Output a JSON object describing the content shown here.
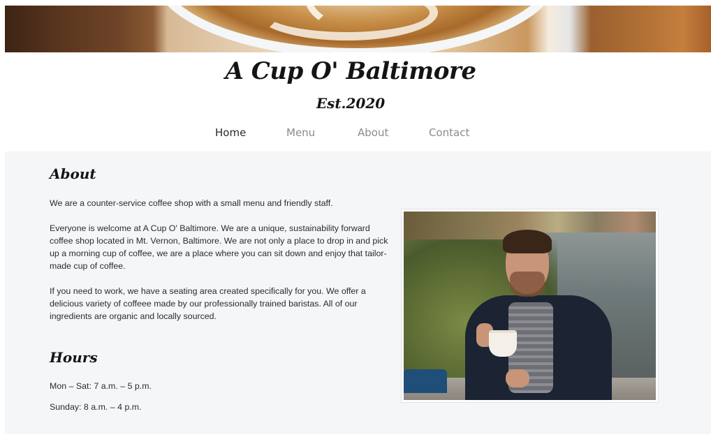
{
  "header": {
    "title": "A Cup O' Baltimore",
    "established": "Est.2020"
  },
  "nav": {
    "items": [
      {
        "label": "Home",
        "active": true
      },
      {
        "label": "Menu",
        "active": false
      },
      {
        "label": "About",
        "active": false
      },
      {
        "label": "Contact",
        "active": false
      }
    ]
  },
  "about": {
    "heading": "About",
    "paragraphs": [
      "We are a counter-service coffee shop with a small menu and friendly staff.",
      "Everyone is welcome at A Cup O' Baltimore. We are a unique, sustainability forward coffee shop located in Mt. Vernon, Baltimore. We are not only a place to drop in and pick up a morning cup of coffee, we are a place where you can sit down and enjoy that tailor-made cup of coffee.",
      "If you need to work, we have a seating area created specifically for you. We offer a delicious variety of coffeee made by our professionally trained baristas. All of our ingredients are organic and locally sourced."
    ]
  },
  "hours": {
    "heading": "Hours",
    "lines": [
      "Mon – Sat: 7 a.m. – 5 p.m.",
      "Sunday: 8 a.m. – 4 p.m."
    ]
  },
  "colors": {
    "active_nav": "#2a2a2a",
    "inactive_nav": "#8a8a8a",
    "section_background": "#f5f6f8"
  }
}
